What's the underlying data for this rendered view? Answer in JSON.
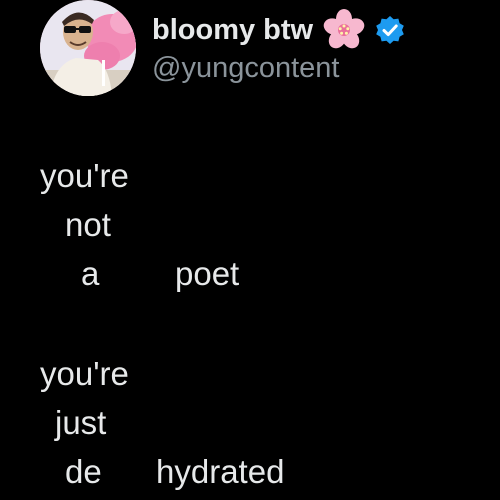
{
  "author": {
    "display_name": "bloomy btw",
    "name_emoji": "cherry-blossom-icon",
    "verified": true,
    "handle": "@yungcontent",
    "avatar": "profile-photo"
  },
  "tweet": {
    "lines": [
      "you're",
      "not",
      "a",
      "poet",
      "you're",
      "just",
      "de",
      "hydrated"
    ]
  },
  "colors": {
    "background": "#000000",
    "text": "#e7e9ea",
    "handle": "#8b949b",
    "verified": "#1d9bf0",
    "blossom": "#f4a7c3"
  }
}
